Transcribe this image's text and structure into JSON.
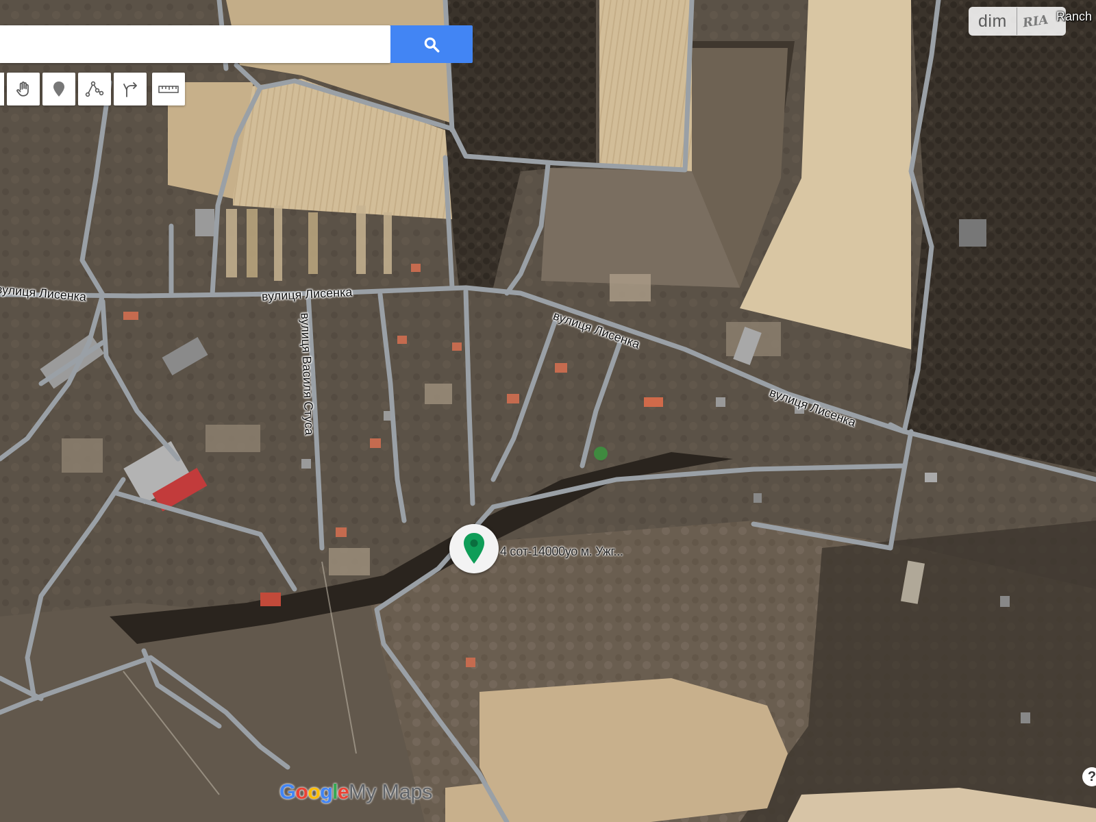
{
  "search": {
    "placeholder": "",
    "value": "",
    "button_icon": "search-icon"
  },
  "toolbar": {
    "tools": [
      {
        "name": "pan",
        "icon": "hand-icon"
      },
      {
        "name": "add-marker",
        "icon": "marker-icon"
      },
      {
        "name": "draw-line",
        "icon": "polyline-icon"
      },
      {
        "name": "directions",
        "icon": "directions-icon"
      },
      {
        "name": "measure",
        "icon": "ruler-icon"
      }
    ]
  },
  "branding": {
    "dim_text": "dim",
    "ria_text": "RIA",
    "corner_label": "Ranch"
  },
  "map_labels": {
    "street_lysenka": "вулиця Лисенка",
    "street_stusa": "вулиця Василя Стуса"
  },
  "marker": {
    "label": "4 сот-14000уо  м. Ужг...",
    "color": "#0f9d58",
    "icon": "location-pin-icon"
  },
  "footer": {
    "google": "Google",
    "mymaps": "My Maps",
    "help": "?"
  },
  "colors": {
    "search_button": "#4285f4",
    "road": "#9aa0a6",
    "marker": "#0f9d58"
  }
}
